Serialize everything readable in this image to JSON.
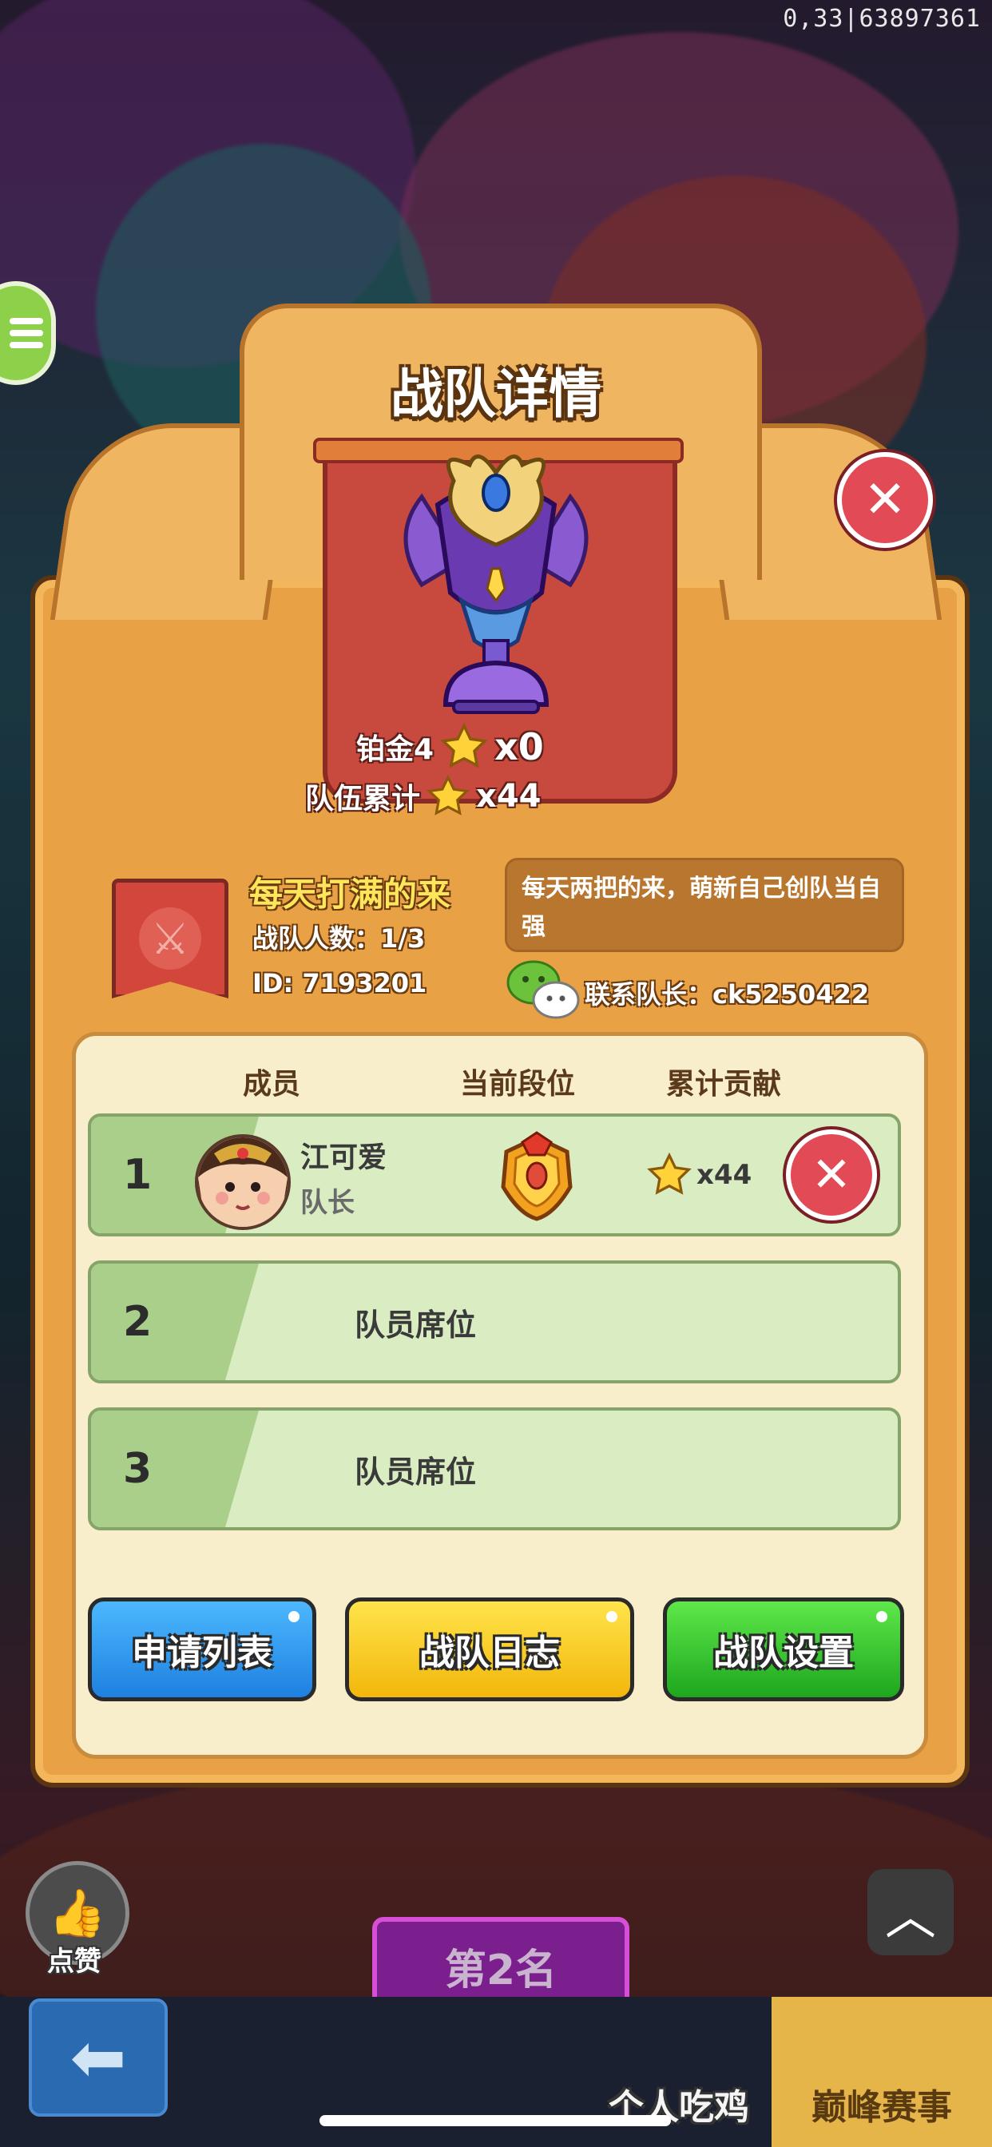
{
  "debug": {
    "text": "0,33|63897361"
  },
  "dialog": {
    "title": "战队详情",
    "rank": {
      "name": "铂金4",
      "stars": "x0"
    },
    "team_total": {
      "label": "队伍累计",
      "stars": "x44"
    },
    "team": {
      "name": "每天打满的来",
      "member_count": "战队人数：1/3",
      "id": "ID: 7193201",
      "description": "每天两把的来，萌新自己创队当自强",
      "contact": "联系队长：ck5250422"
    },
    "columns": {
      "member": "成员",
      "rank": "当前段位",
      "contribution": "累计贡献"
    },
    "members": [
      {
        "index": "1",
        "name": "江可爱",
        "role": "队长",
        "contribution": "x44"
      },
      {
        "index": "2",
        "seat_label": "队员席位"
      },
      {
        "index": "3",
        "seat_label": "队员席位"
      }
    ],
    "buttons": {
      "apply_list": "申请列表",
      "team_log": "战队日志",
      "team_settings": "战队设置"
    }
  },
  "background": {
    "like_label": "点赞",
    "rank_banner": "第2名",
    "tabs": {
      "eat": "个人吃鸡",
      "peak": "巅峰赛事"
    }
  },
  "colors": {
    "dialog_bg": "#e8a145",
    "banner_red": "#c8493e",
    "row_green": "#d9ecc2",
    "gold_text": "#ffe55a"
  }
}
